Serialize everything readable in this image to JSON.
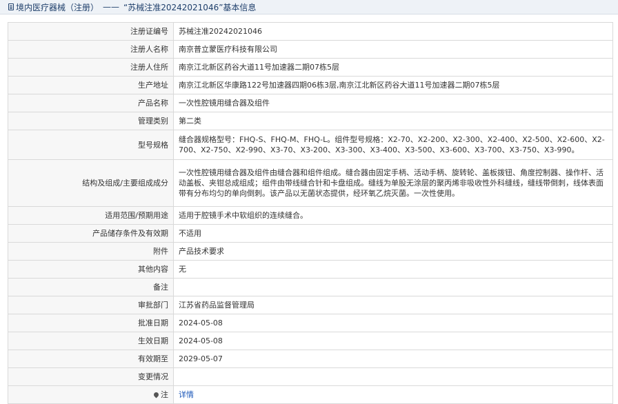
{
  "header": {
    "section": "境内医疗器械（注册）",
    "separator": "——",
    "title": "“苏械注准20242021046”基本信息"
  },
  "rows": [
    {
      "label": "注册证编号",
      "value": "苏械注准20242021046"
    },
    {
      "label": "注册人名称",
      "value": "南京普立蒙医疗科技有限公司"
    },
    {
      "label": "注册人住所",
      "value": "南京江北新区药谷大道11号加速器二期07栋5层"
    },
    {
      "label": "生产地址",
      "value": "南京江北新区华康路122号加速器四期06栋3层,南京江北新区药谷大道11号加速器二期07栋5层"
    },
    {
      "label": "产品名称",
      "value": "一次性腔镜用缝合器及组件"
    },
    {
      "label": "管理类别",
      "value": "第二类"
    },
    {
      "label": "型号规格",
      "value": "缝合器规格型号：FHQ-S、FHQ-M、FHQ-L。组件型号规格：X2-70、X2-200、X2-300、X2-400、X2-500、X2-600、X2-700、X2-750、X2-990、X3-70、X3-200、X3-300、X3-400、X3-500、X3-600、X3-700、X3-750、X3-990。"
    },
    {
      "label": "结构及组成/主要组成成分",
      "value": "一次性腔镜用缝合器及组件由缝合器和组件组成。缝合器由固定手柄、活动手柄、旋转轮、盖板拨钮、角度控制器、操作杆、活动盖板、夹钳总成组成；组件由带线缝合针和卡盘组成。缝线为单股无涂层的聚丙烯非吸收性外科缝线，缝线带倒刺，线体表面带有分布均匀的单向倒刺。该产品以无菌状态提供，经环氧乙烷灭菌。一次性使用。"
    },
    {
      "label": "适用范围/预期用途",
      "value": "适用于腔镜手术中软组织的连续缝合。"
    },
    {
      "label": "产品储存条件及有效期",
      "value": "不适用"
    },
    {
      "label": "附件",
      "value": "产品技术要求"
    },
    {
      "label": "其他内容",
      "value": "无"
    },
    {
      "label": "备注",
      "value": ""
    },
    {
      "label": "审批部门",
      "value": "江苏省药品监督管理局"
    },
    {
      "label": "批准日期",
      "value": "2024-05-08"
    },
    {
      "label": "生效日期",
      "value": "2024-05-08"
    },
    {
      "label": "有效期至",
      "value": "2029-05-07"
    },
    {
      "label": "变更情况",
      "value": ""
    }
  ],
  "note": {
    "label": "注",
    "link_text": "详情",
    "icon": "pin-icon"
  },
  "colors": {
    "header_bg": "#eef2f7",
    "header_text": "#1f3f6b",
    "label_bg": "#f7f7f7",
    "border": "#d9d9d9",
    "link": "#1a56b8"
  }
}
